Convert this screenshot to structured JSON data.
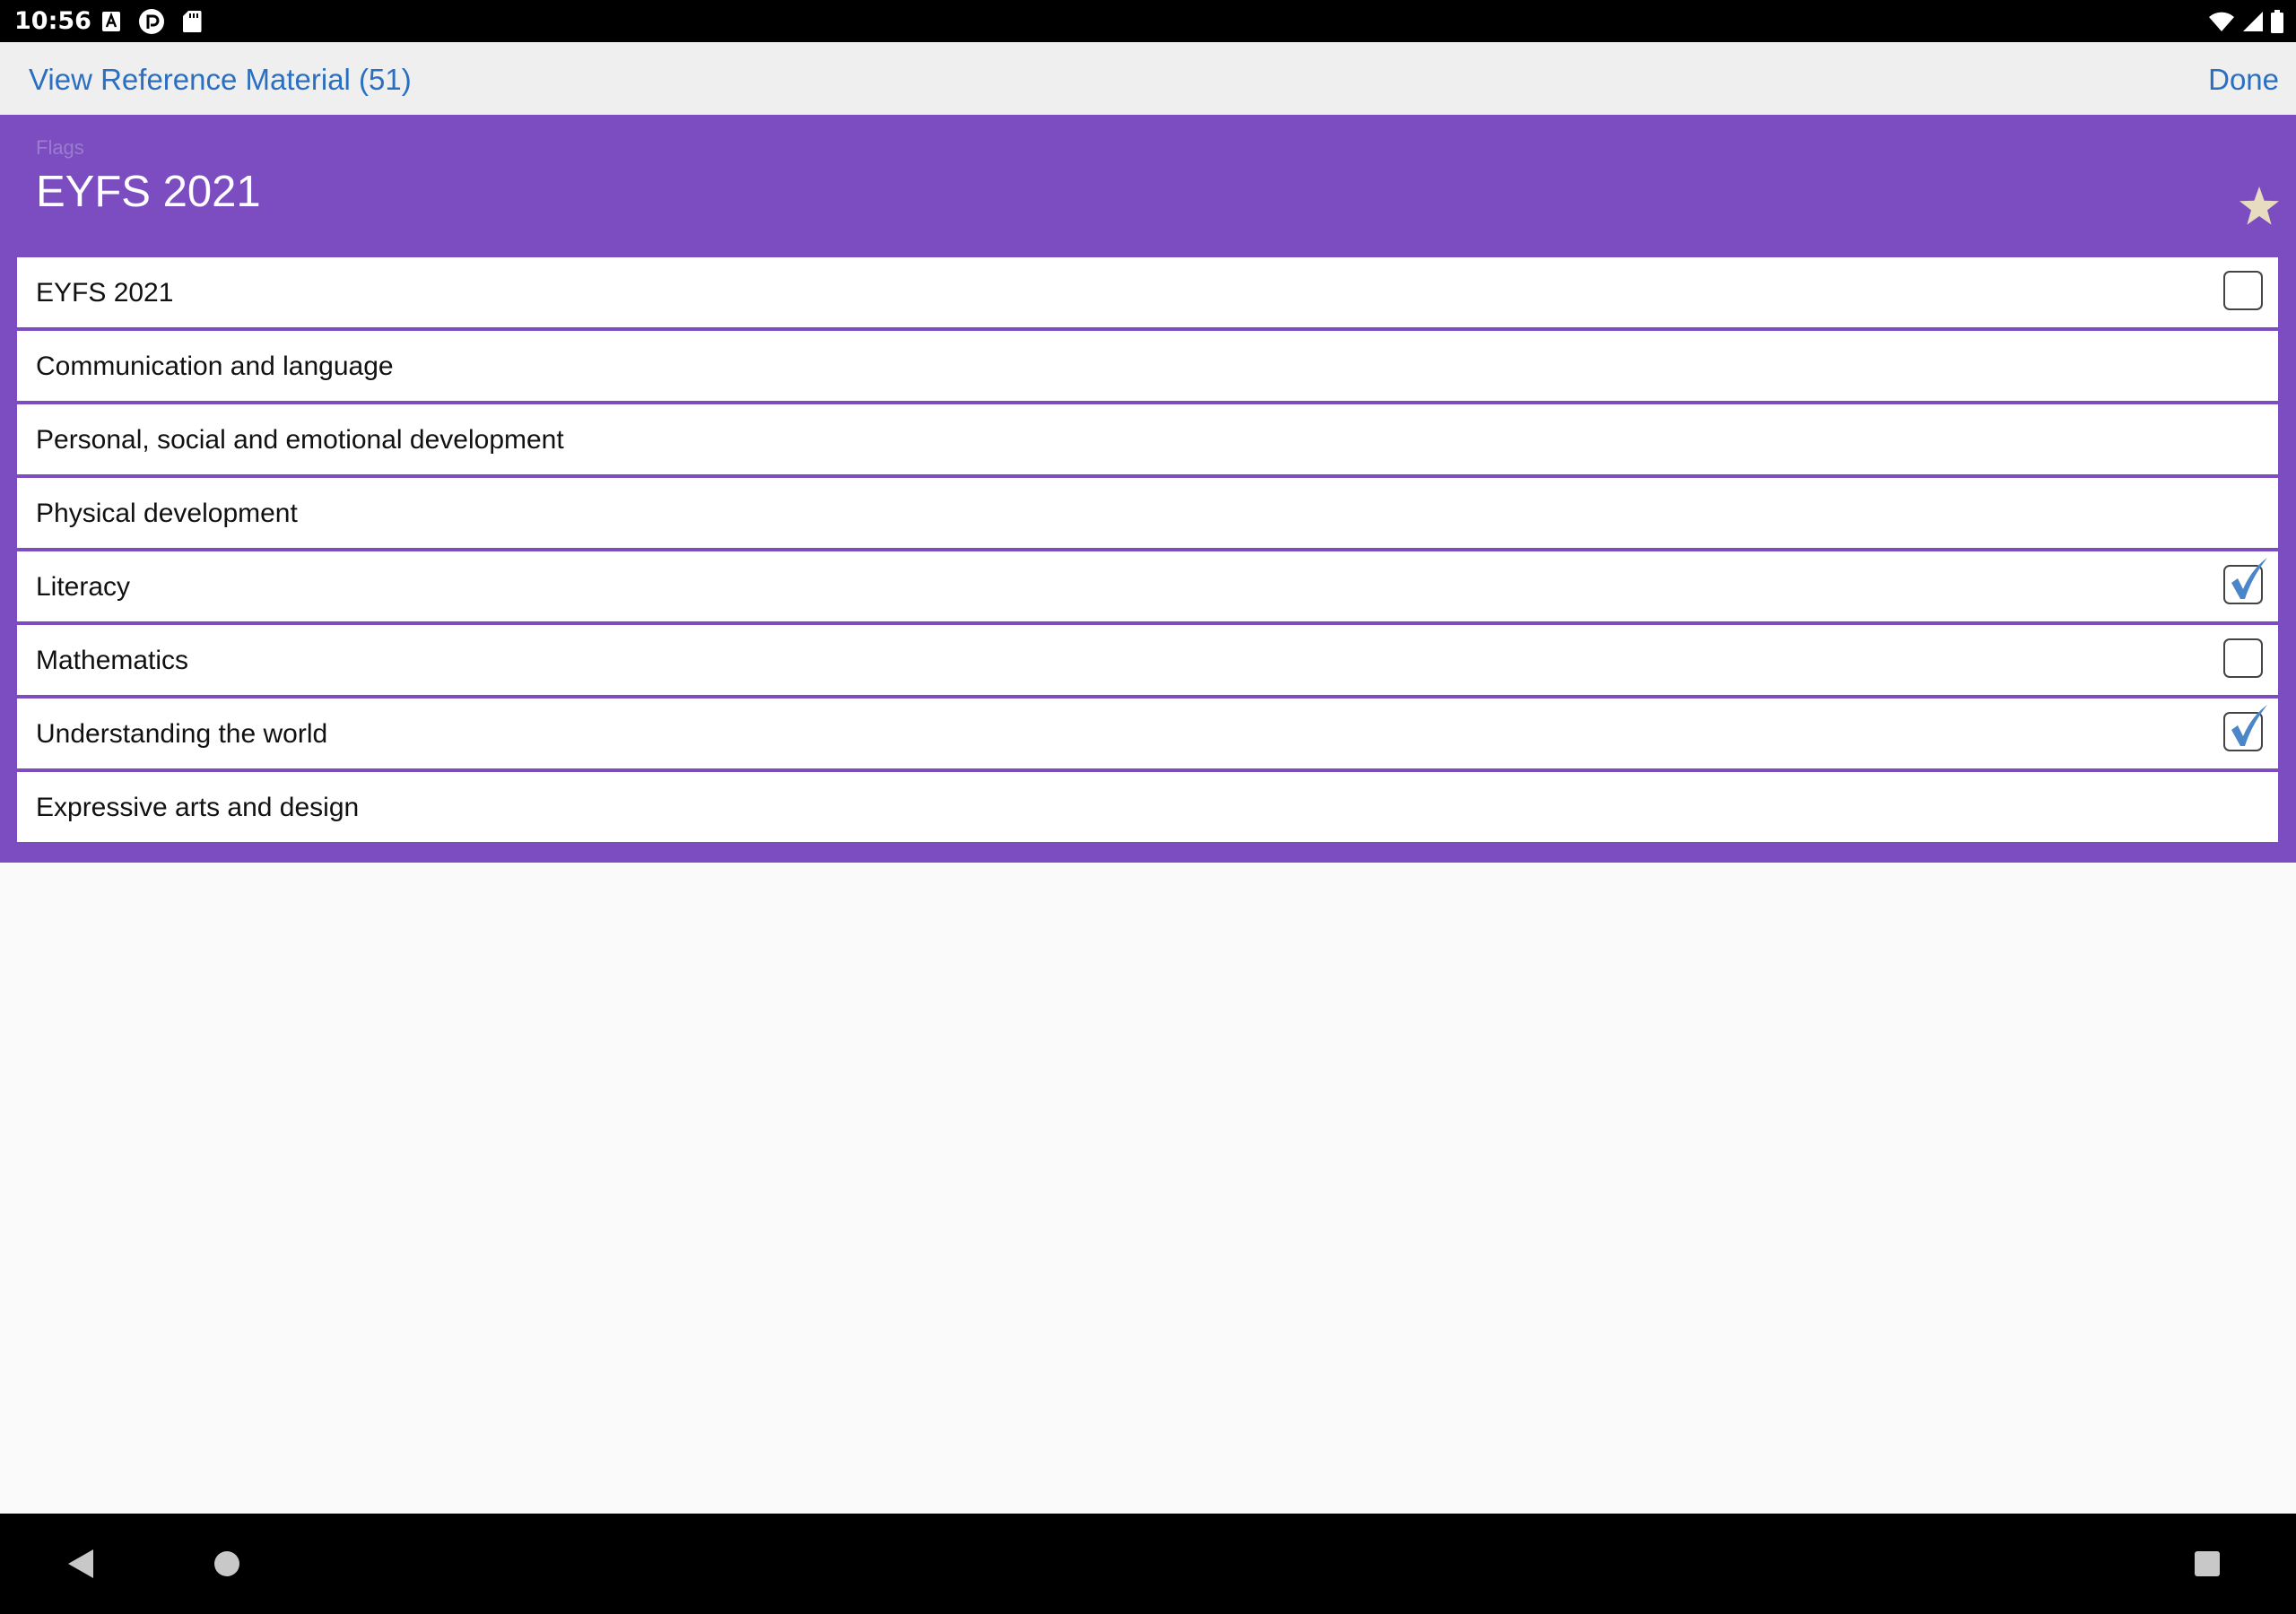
{
  "status_bar": {
    "time": "10:56",
    "icons_left": [
      "a-notification-icon",
      "pocket-casts-icon",
      "sd-card-icon"
    ],
    "icons_right": [
      "wifi-icon",
      "signal-icon",
      "battery-icon"
    ]
  },
  "app_bar": {
    "back_label": "View Reference Material (51)",
    "done_label": "Done"
  },
  "panel": {
    "kicker": "Flags",
    "title": "EYFS 2021",
    "favorite_icon": "star-icon",
    "rows": [
      {
        "label": "EYFS 2021",
        "checkbox": true,
        "checked": false
      },
      {
        "label": "Communication and language",
        "checkbox": false,
        "checked": false
      },
      {
        "label": "Personal, social and emotional development",
        "checkbox": false,
        "checked": false
      },
      {
        "label": "Physical development",
        "checkbox": false,
        "checked": false
      },
      {
        "label": "Literacy",
        "checkbox": true,
        "checked": true
      },
      {
        "label": "Mathematics",
        "checkbox": true,
        "checked": false
      },
      {
        "label": "Understanding the world",
        "checkbox": true,
        "checked": true
      },
      {
        "label": "Expressive arts and design",
        "checkbox": false,
        "checked": false
      }
    ]
  },
  "nav_bar": {
    "buttons": [
      "back-triangle-icon",
      "home-circle-icon",
      "recents-square-icon"
    ]
  },
  "colors": {
    "panel": "#7c4dc0",
    "link": "#2b6fc0",
    "check": "#4a86c8",
    "star": "#e8dcc0"
  }
}
